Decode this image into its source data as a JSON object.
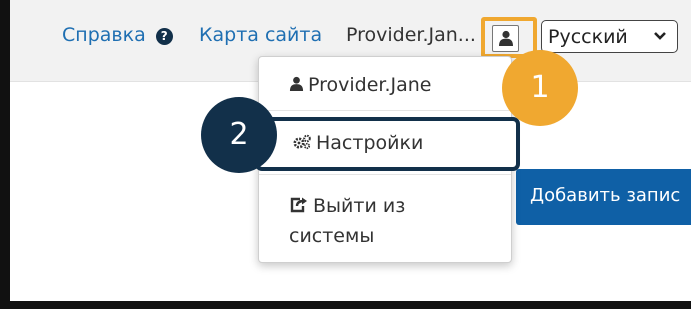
{
  "header": {
    "help_label": "Справка",
    "help_icon": "question-circle-icon",
    "sitemap_label": "Карта сайта",
    "user_name": "Provider.Jan...",
    "user_button_icon": "user-icon",
    "language": {
      "selected": "Русский"
    }
  },
  "user_menu": {
    "profile_label": "Provider.Jane",
    "settings_label": "Настройки",
    "logout_label": "Выйти из системы",
    "logout_line1": "Выйти из",
    "logout_line2": "системы"
  },
  "main": {
    "add_button_label": "Добавить запис"
  },
  "annotations": {
    "step1_label": "1",
    "step2_label": "2"
  },
  "colors": {
    "link": "#1f6fb2",
    "highlight_orange": "#f0a830",
    "highlight_navy": "#12304a",
    "primary_button": "#0f60a6"
  }
}
